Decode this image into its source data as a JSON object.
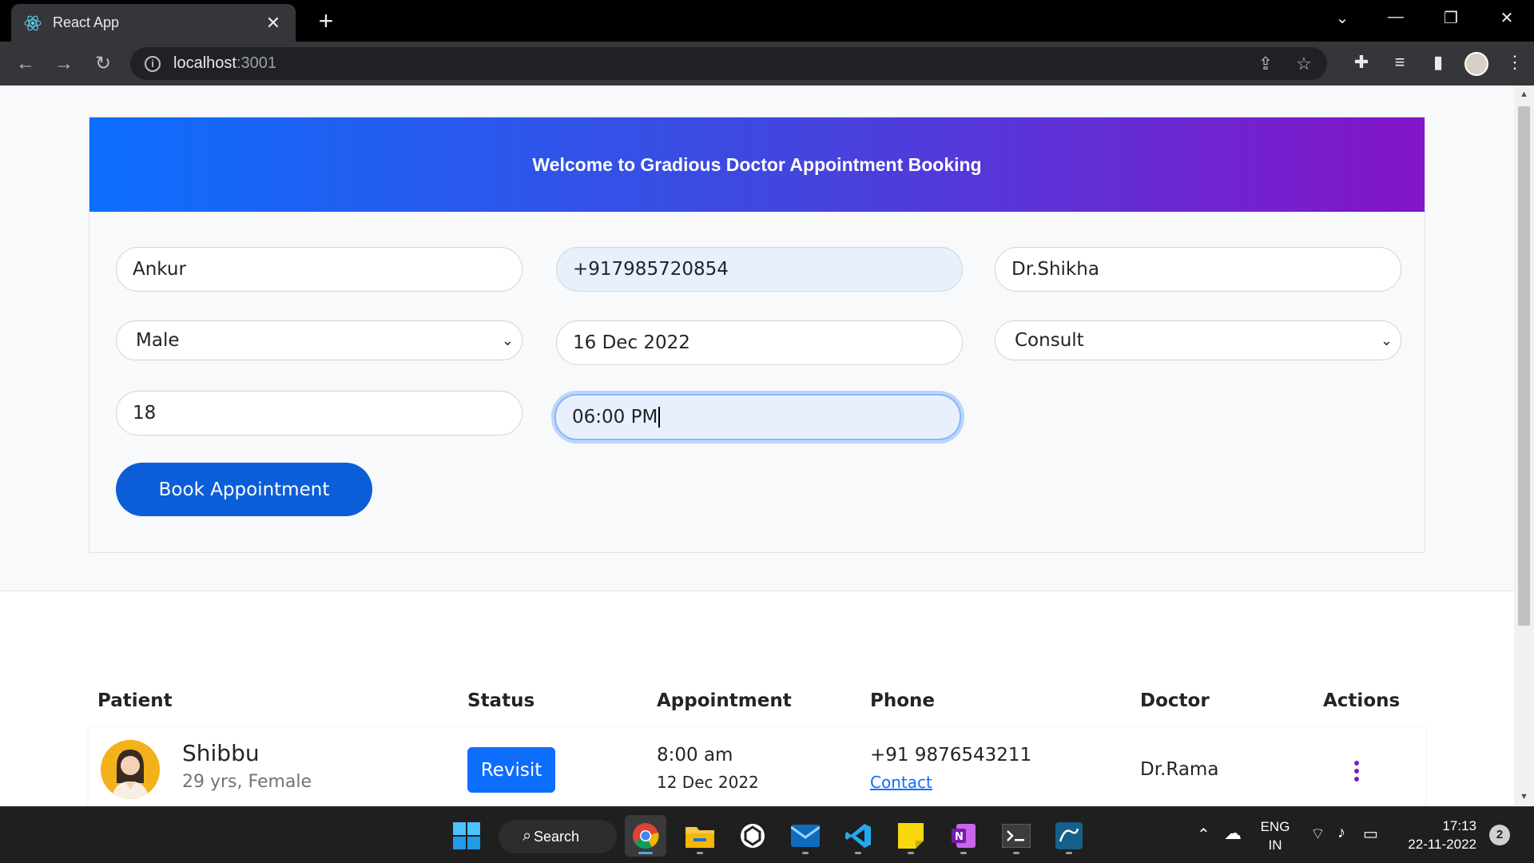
{
  "browser": {
    "tab_title": "React App",
    "url_host": "localhost",
    "url_port": ":3001"
  },
  "page": {
    "banner_title": "Welcome to Gradious Doctor Appointment Booking",
    "form": {
      "patient_name": "Ankur",
      "phone": "+917985720854",
      "doctor": "Dr.Shikha",
      "gender": "Male",
      "date": "16 Dec 2022",
      "appointment_type": "Consult",
      "age": "18",
      "time": "06:00 PM",
      "book_button": "Book Appointment"
    },
    "table": {
      "headers": [
        "Patient",
        "Status",
        "Appointment",
        "Phone",
        "Doctor",
        "Actions"
      ],
      "rows": [
        {
          "name": "Shibbu",
          "info": "29 yrs, Female",
          "status": "Revisit",
          "time": "8:00 am",
          "date": "12 Dec 2022",
          "phone": "+91 9876543211",
          "contact_label": "Contact",
          "doctor": "Dr.Rama"
        }
      ]
    }
  },
  "taskbar": {
    "search_label": "Search",
    "lang_top": "ENG",
    "lang_bottom": "IN",
    "time": "17:13",
    "date": "22-11-2022",
    "notification_count": "2"
  },
  "colors": {
    "banner_start": "#0d6efd",
    "banner_end": "#8414c8",
    "primary": "#0d6efd",
    "book_button": "#0b5ed7",
    "actions_kebab": "#7b1fc4"
  }
}
